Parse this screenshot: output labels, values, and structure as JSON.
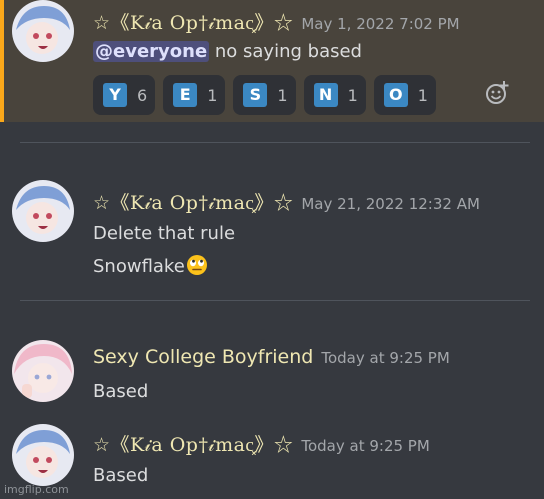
{
  "messages": [
    {
      "username": "☆《K𝒾a Op†𝒾mac͓》☆",
      "timestamp": "May 1, 2022 7:02 PM",
      "mention": "@everyone",
      "text_after_mention": " no saying based",
      "reactions": [
        {
          "emoji": "Y",
          "count": "6"
        },
        {
          "emoji": "E",
          "count": "1"
        },
        {
          "emoji": "S",
          "count": "1"
        },
        {
          "emoji": "N",
          "count": "1"
        },
        {
          "emoji": "O",
          "count": "1"
        }
      ]
    },
    {
      "username": "☆《K𝒾a Op†𝒾mac͓》☆",
      "timestamp": "May 21, 2022 12:32 AM",
      "line1": "Delete that rule",
      "line2": "Snowflake"
    },
    {
      "username": "Sexy College Boyfriend",
      "timestamp": "Today at 9:25 PM",
      "text": "Based"
    },
    {
      "username": "☆《K𝒾a Op†𝒾mac͓》☆",
      "timestamp": "Today at 9:25 PM",
      "text": "Based"
    }
  ],
  "icons": {
    "add_reaction": "add-reaction-icon",
    "rolling_eyes": "rolling-eyes-emoji"
  },
  "watermark": "imgflip.com",
  "colors": {
    "background": "#36393f",
    "mention_highlight": "#49443c",
    "mention_bar": "#faa81a",
    "username": "#efe7b2",
    "timestamp": "#a3a6aa",
    "reaction_key": "#3b88c3"
  }
}
